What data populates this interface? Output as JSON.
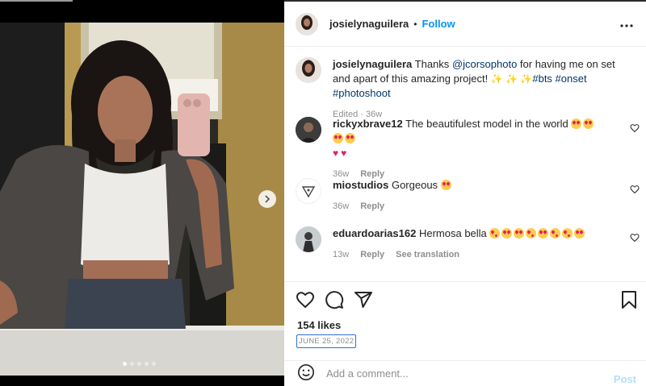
{
  "post": {
    "author": "josielynaguilera",
    "separator": "•",
    "follow_label": "Follow",
    "more_icon": "more-horizontal-icon",
    "caption": {
      "username": "josielynaguilera",
      "text_before": "Thanks ",
      "mention": "@jcorsophoto",
      "text_after": " for having me on set and apart of this amazing project!",
      "hashtags": "#bts #onset #photoshoot",
      "edited": "Edited · 36w"
    },
    "comments": [
      {
        "username": "rickyxbrave12",
        "text": "The beautifulest model in the world",
        "time": "36w",
        "reply_label": "Reply"
      },
      {
        "username": "miostudios",
        "text": "Gorgeous",
        "time": "36w",
        "reply_label": "Reply"
      },
      {
        "username": "eduardoarias162",
        "text": "Hermosa bella",
        "time": "13w",
        "reply_label": "Reply",
        "translate_label": "See translation"
      }
    ],
    "likes": "154 likes",
    "date": "JUNE 25, 2022",
    "add_comment_placeholder": "Add a comment...",
    "post_label": "Post",
    "carousel": {
      "count": 5,
      "active": 0
    }
  },
  "colors": {
    "accent": "#0095f6",
    "link": "#00376b",
    "muted": "#8e8e8e",
    "post_disabled": "#b2dffc"
  }
}
